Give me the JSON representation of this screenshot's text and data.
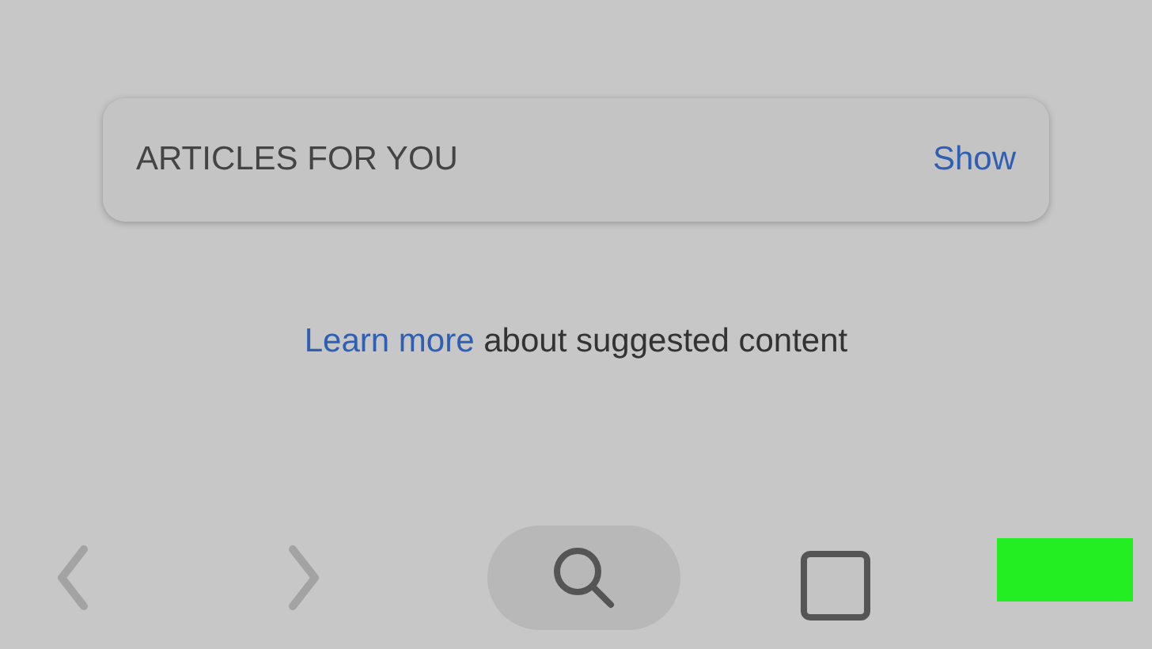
{
  "card": {
    "title": "ARTICLES FOR YOU",
    "action": "Show"
  },
  "note": {
    "link": "Learn more",
    "text": " about suggested content"
  },
  "toolbar": [
    {
      "kind": "back"
    },
    {
      "kind": "forward"
    },
    {
      "kind": "search"
    },
    {
      "kind": "tabs"
    },
    {
      "kind": "highlight"
    }
  ]
}
